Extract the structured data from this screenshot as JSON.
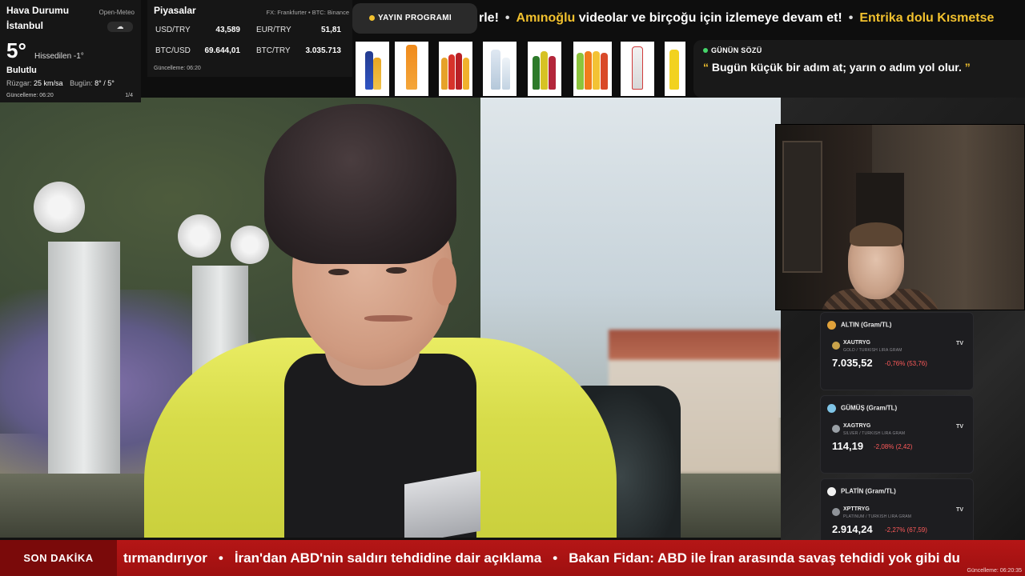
{
  "weather": {
    "title": "Hava Durumu",
    "source": "Open-Meteo",
    "city": "İstanbul",
    "temp": "5°",
    "feels_like": "Hissedilen -1°",
    "condition": "Bulutlu",
    "wind_label": "Rüzgar:",
    "wind_value": "25 km/sa",
    "today_label": "Bugün:",
    "today_value": "8° / 5°",
    "updated": "Güncelleme: 06:20",
    "page": "1/4",
    "icon": "cloud-icon"
  },
  "markets": {
    "title": "Piyasalar",
    "source": "FX: Frankfurter • BTC: Binance",
    "rows": [
      {
        "key": "USD/TRY",
        "value": "43,589"
      },
      {
        "key": "EUR/TRY",
        "value": "51,81"
      },
      {
        "key": "BTC/USD",
        "value": "69.644,01"
      },
      {
        "key": "BTC/TRY",
        "value": "3.035.713"
      }
    ],
    "updated": "Güncelleme: 06:20"
  },
  "schedule_button": "YAYIN PROGRAMI",
  "top_ticker": {
    "part1": "rle!",
    "part2_highlight": "Amınoğlu",
    "part2_rest": " videolar ve birçoğu için izlemeye devam et!",
    "part3_highlight": "Entrika dolu Kısmetse",
    "separator": "•"
  },
  "quote": {
    "heading": "GÜNÜN SÖZÜ",
    "open_mark": "“",
    "text": "Bugün küçük bir adım at; yarın o adım yol olur.",
    "close_mark": "”"
  },
  "cards": [
    {
      "title": "ALTIN (Gram/TL)",
      "symbol": "XAUTRYG",
      "subtitle": "GOLD / TURKISH LIRA GRAM",
      "price": "7.035,52",
      "change": "-0,76% (53,76)",
      "icon_color": "#e0a13a",
      "badge_color": "#c9a24a"
    },
    {
      "title": "GÜMÜŞ (Gram/TL)",
      "symbol": "XAGTRYG",
      "subtitle": "SILVER / TURKISH LIRA GRAM",
      "price": "114,19",
      "change": "-2,08% (2,42)",
      "icon_color": "#7fc4e6",
      "badge_color": "#9aa0a6"
    },
    {
      "title": "PLATİN (Gram/TL)",
      "symbol": "XPTTRYG",
      "subtitle": "PLATINUM / TURKISH LIRA GRAM",
      "price": "2.914,24",
      "change": "-2,27% (67,59)",
      "icon_color": "#f2f2f2",
      "badge_color": "#8f9399"
    }
  ],
  "tv_logo": "TV",
  "breaking": {
    "label": "SON DAKİKA",
    "items": [
      "tırmandırıyor",
      "İran'dan ABD'nin saldırı tehdidine dair açıklama",
      "Bakan Fidan: ABD ile İran arasında savaş tehdidi yok gibi du"
    ],
    "separator": "•",
    "updated": "Güncelleme: 06:20:35"
  },
  "colors": {
    "accent_yellow": "#f2c12e",
    "breaking_red": "#b51616",
    "negative": "#ff5a5a",
    "live_green": "#45d66a"
  }
}
